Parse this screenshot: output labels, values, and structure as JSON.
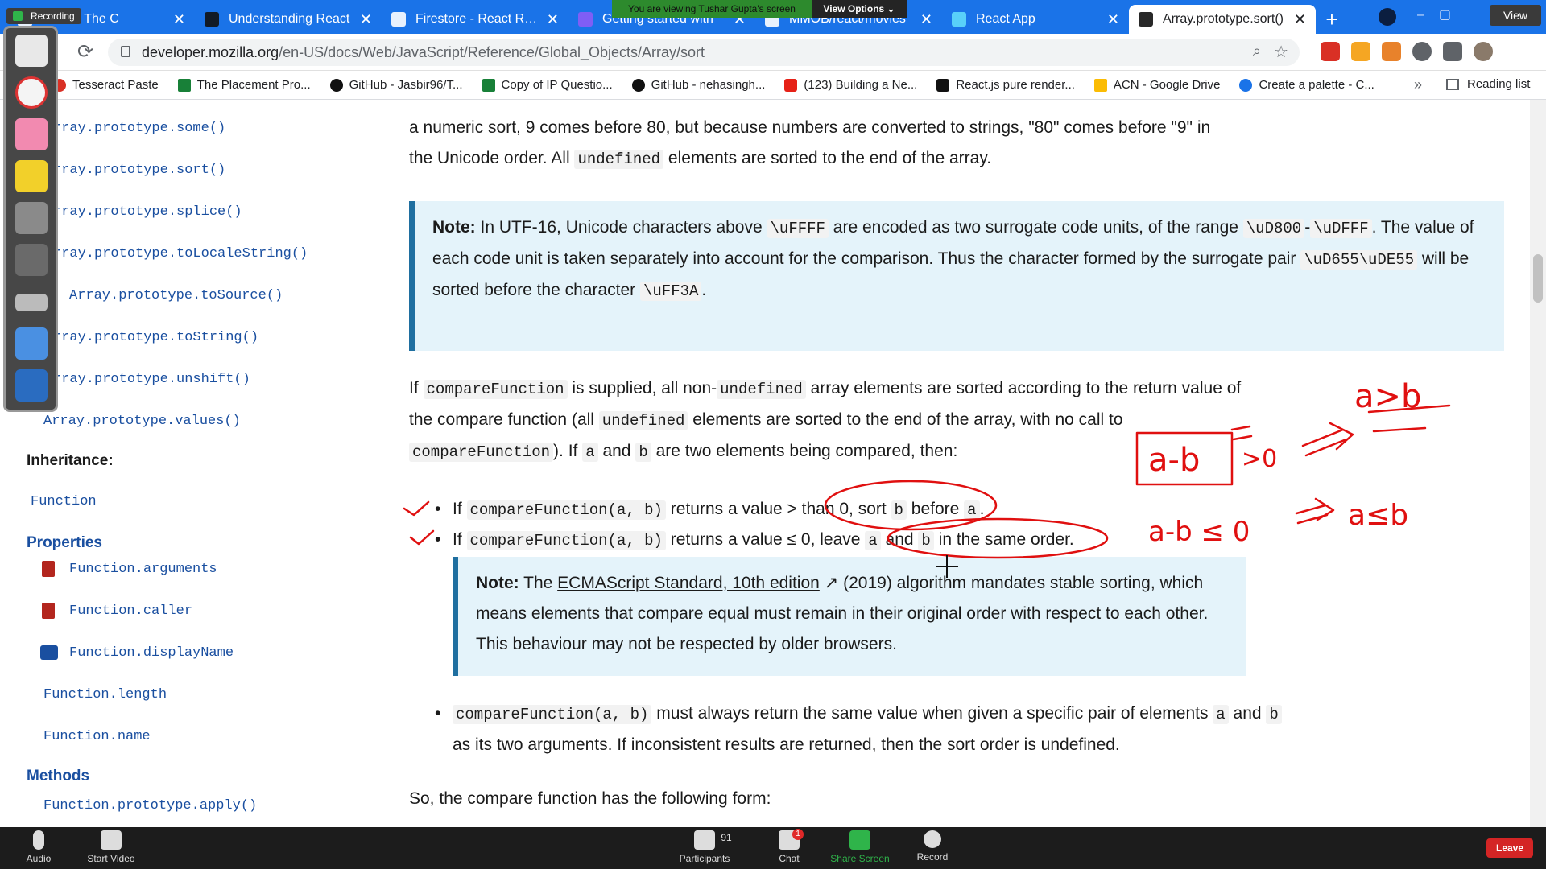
{
  "browser": {
    "tabs": [
      {
        "label": "utorial: The C"
      },
      {
        "label": "Understanding React"
      },
      {
        "label": "Firestore - React Redu"
      },
      {
        "label": "Getting started with"
      },
      {
        "label": "MMOB/react/movies"
      },
      {
        "label": "React App"
      },
      {
        "label": "Array.prototype.sort()"
      }
    ],
    "url_host": "developer.mozilla.org",
    "url_path": "/en-US/docs/Web/JavaScript/Reference/Global_Objects/Array/sort",
    "view_label": "View",
    "bookmarks": [
      {
        "label": "Tesseract Paste",
        "color": "#d93025"
      },
      {
        "label": "The Placement Pro...",
        "color": "#188038"
      },
      {
        "label": "GitHub - Jasbir96/T...",
        "color": "#111111"
      },
      {
        "label": "Copy of IP Questio...",
        "color": "#188038"
      },
      {
        "label": "GitHub - nehasingh...",
        "color": "#111111"
      },
      {
        "label": "(123) Building a Ne...",
        "color": "#e62117"
      },
      {
        "label": "React.js pure render...",
        "color": "#111111"
      },
      {
        "label": "ACN - Google Drive",
        "color": "#fbbc04"
      },
      {
        "label": "Create a palette - C...",
        "color": "#1a73e8"
      }
    ],
    "bookmarks_more": "»",
    "reading_list": "Reading list"
  },
  "zoom_share": {
    "recording_label": "Recording",
    "viewing_banner": "You are viewing Tushar Gupta's screen",
    "view_options": "View Options ⌄"
  },
  "sidebar": {
    "links": [
      "rray.prototype.some()",
      "rray.prototype.sort()",
      "rray.prototype.splice()",
      "rray.prototype.toLocaleString()",
      "Array.prototype.toSource()",
      "rray.prototype.toString()",
      "rray.prototype.unshift()",
      "Array.prototype.values()"
    ],
    "inheritance_heading": "Inheritance:",
    "inheritance_link": "Function",
    "properties_heading": "Properties",
    "properties": [
      "Function.arguments",
      "Function.caller",
      "Function.displayName",
      "Function.length",
      "Function.name"
    ],
    "methods_heading": "Methods",
    "methods": [
      "Function.prototype.apply()"
    ]
  },
  "content": {
    "intro_line1": "a numeric sort, 9 comes before 80, but because numbers are converted to strings, \"80\" comes before \"9\" in",
    "intro_line2_a": "the Unicode order. All ",
    "intro_line2_code": "undefined",
    "intro_line2_b": " elements are sorted to the end of the array.",
    "note1": {
      "label": "Note:",
      "t1": " In UTF-16, Unicode characters above ",
      "c1": "\\uFFFF",
      "t2": " are encoded as two surrogate code units, of the range ",
      "c2": "\\uD800",
      "t3": "-",
      "c3": "\\uDFFF",
      "t4": ". The value of each code unit is taken separately into account for the comparison. Thus the character formed by the surrogate pair ",
      "c4": "\\uD655\\uDE55",
      "t5": " will be sorted before the character ",
      "c5": "\\uFF3A",
      "t6": "."
    },
    "para2": {
      "t1": "If ",
      "c1": "compareFunction",
      "t2": " is supplied, all non-",
      "c2": "undefined",
      "t3": " array elements are sorted according to the return value of the compare function (all ",
      "c3": "undefined",
      "t4": " elements are sorted to the end of the array, with no call to ",
      "c4": "compareFunction",
      "t5": "). If ",
      "c5": "a",
      "t6": " and ",
      "c6": "b",
      "t7": " are two elements being compared, then:"
    },
    "bullet1": {
      "t1": "If ",
      "c1": "compareFunction(a, b)",
      "t2": " returns a value > than 0, sort ",
      "c2": "b",
      "t3": " before ",
      "c3": "a",
      "t4": "."
    },
    "bullet2": {
      "t1": "If ",
      "c1": "compareFunction(a, b)",
      "t2": " returns a value ≤ 0, leave ",
      "c2": "a",
      "t3": " and ",
      "c3": "b",
      "t4": " in the same order."
    },
    "note2": {
      "label": "Note:",
      "t1": " The ",
      "link": "ECMAScript Standard, 10th edition",
      "t2": " (2019) algorithm mandates stable sorting, which means elements that compare equal must remain in their original order with respect to each other. This behaviour may not be respected by older browsers."
    },
    "bullet3": {
      "c1": "compareFunction(a, b)",
      "t1": " must always return the same value when given a specific pair of elements ",
      "c2": "a",
      "t2": " and ",
      "c3": "b",
      "t3": " as its two arguments. If inconsistent results are returned, then the sort order is undefined."
    },
    "outro": "So, the compare function has the following form:"
  },
  "annotations": {
    "a_gt_b": "a>b",
    "a_minus_b": "a-b",
    "gt_zero": ">0",
    "a_minus_b_le_0": "a-b ≤ 0",
    "a_le_b": "a≤b",
    "arrow": "=>",
    "equals": "="
  },
  "zoom_controls": {
    "audio": "Audio",
    "start_video": "Start Video",
    "participants": "Participants",
    "participants_count": "91",
    "chat": "Chat",
    "chat_badge": "1",
    "share_screen": "Share Screen",
    "record": "Record",
    "leave": "Leave"
  },
  "colors": {
    "chrome_blue": "#1a73e8",
    "mdn_link": "#1a4fa0",
    "note_bg": "#e4f3fa",
    "note_border": "#1f6fa0",
    "ink_red": "#e01010",
    "zoom_bar": "#1c1c1c",
    "share_green": "#2fb44a"
  }
}
